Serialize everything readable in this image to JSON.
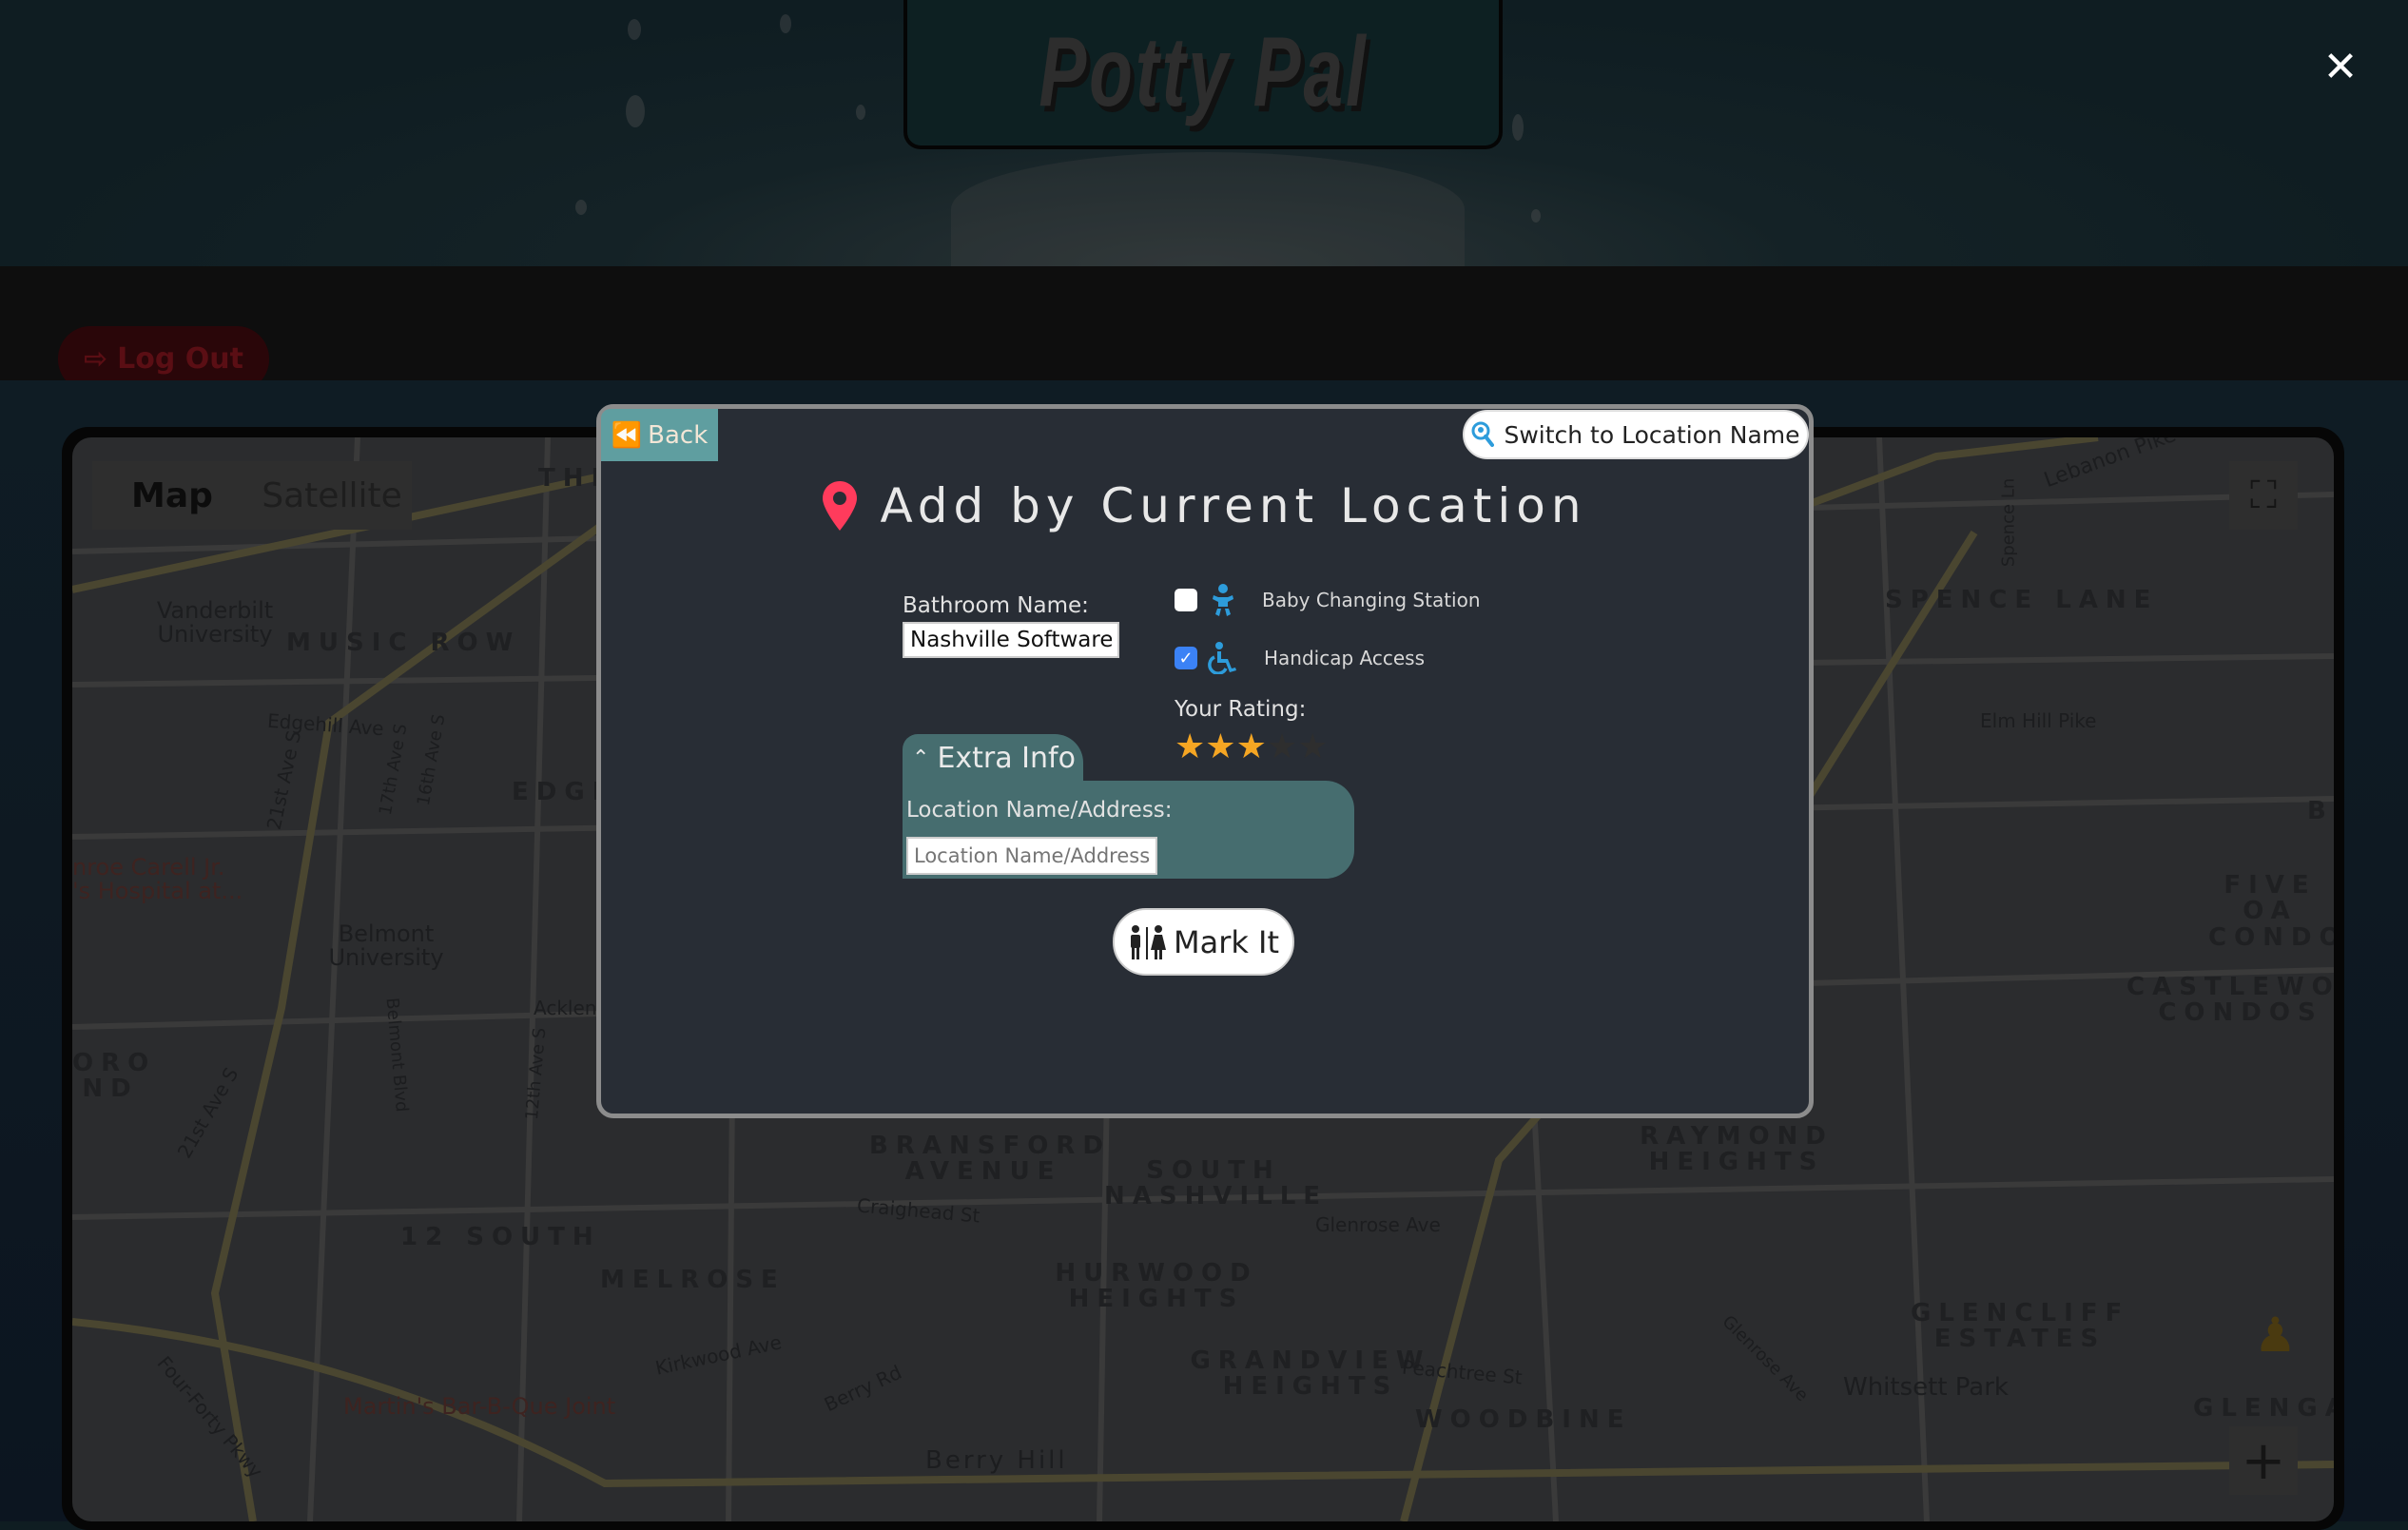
{
  "header": {
    "logo_text": "Potty Pal",
    "close_icon": "close-icon",
    "logout_label": "Log Out",
    "logout_icon": "sign-out-icon"
  },
  "map": {
    "type_toggle": {
      "map_label": "Map",
      "satellite_label": "Satellite",
      "selected": "Map"
    },
    "labels": [
      "Vanderbilt University",
      "MUSIC ROW",
      "Edgehill Ave",
      "21st Ave S",
      "nroe Carell Jr. 's Hospital at...",
      "EDGE",
      "Belmont University",
      "Acklen",
      "ORO ND",
      "12 SOUTH",
      "MELROSE",
      "Martin's Bar-B-Que Joint",
      "Four-Forty Pkwy",
      "BRANSFORD AVENUE",
      "SOUTH NASHVILLE",
      "Craighead St",
      "Glenrose Ave",
      "HURWOOD HEIGHTS",
      "GRANDVIEW HEIGHTS",
      "Peachtree St",
      "WOODBINE",
      "Berry Hill",
      "Kirkwood Ave",
      "Berry Rd",
      "RAYMOND HEIGHTS",
      "GLENCLIFF ESTATES",
      "Whitsett Park",
      "GLENGAR",
      "SPENCE LANE",
      "Elm Hill Pike",
      "Lebanon Pike",
      "FIVE OA CONDO",
      "CASTLEWOOD CONDOS",
      "BE",
      "17th Ave S",
      "16th Ave S",
      "Belmont Blvd",
      "12th Ave S",
      "21st Ave S",
      "Spence Ln",
      "Glenrose Ave",
      "THE"
    ]
  },
  "modal": {
    "back_label": "Back",
    "switch_label": "Switch to Location Name",
    "title": "Add by Current Location",
    "bathroom_name_label": "Bathroom Name:",
    "bathroom_name_value": "Nashville Software S",
    "amenities": [
      {
        "label": "Baby Changing Station",
        "checked": false,
        "icon": "baby-icon"
      },
      {
        "label": "Handicap Access",
        "checked": true,
        "icon": "wheelchair-icon"
      }
    ],
    "rating_label": "Your Rating:",
    "rating": 3,
    "rating_max": 5,
    "extra_info_label": "Extra Info",
    "location_label": "Location Name/Address:",
    "location_placeholder": "Location Name/Address",
    "location_value": "",
    "mark_it_label": "Mark It",
    "colors": {
      "accent_teal": "#5f9ea0",
      "panel_teal": "#466d6f",
      "pin": "#ff3b5c",
      "icon_blue": "#2d9cdb",
      "star": "#f5a623",
      "checkbox": "#3b82f6"
    }
  }
}
